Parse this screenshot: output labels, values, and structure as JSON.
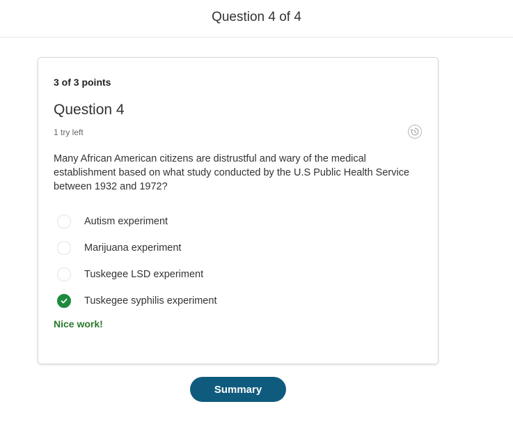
{
  "header": {
    "title": "Question 4 of 4"
  },
  "question": {
    "points": "3 of 3 points",
    "title": "Question 4",
    "tries_left": "1 try left",
    "history_icon": "history-icon",
    "text": "Many African American citizens are distrustful and wary of the medical establishment based on what study conducted by the U.S Public Health Service between 1932 and 1972?",
    "options": [
      {
        "label": "Autism experiment",
        "selected": false
      },
      {
        "label": "Marijuana experiment",
        "selected": false
      },
      {
        "label": "Tuskegee LSD experiment",
        "selected": false
      },
      {
        "label": "Tuskegee syphilis experiment",
        "selected": true,
        "status": "correct"
      }
    ],
    "feedback": "Nice work!"
  },
  "footer": {
    "summary_label": "Summary"
  },
  "colors": {
    "correct": "#1e8a3e",
    "feedback": "#2a7a2e",
    "primary_button": "#0f5b7e"
  }
}
